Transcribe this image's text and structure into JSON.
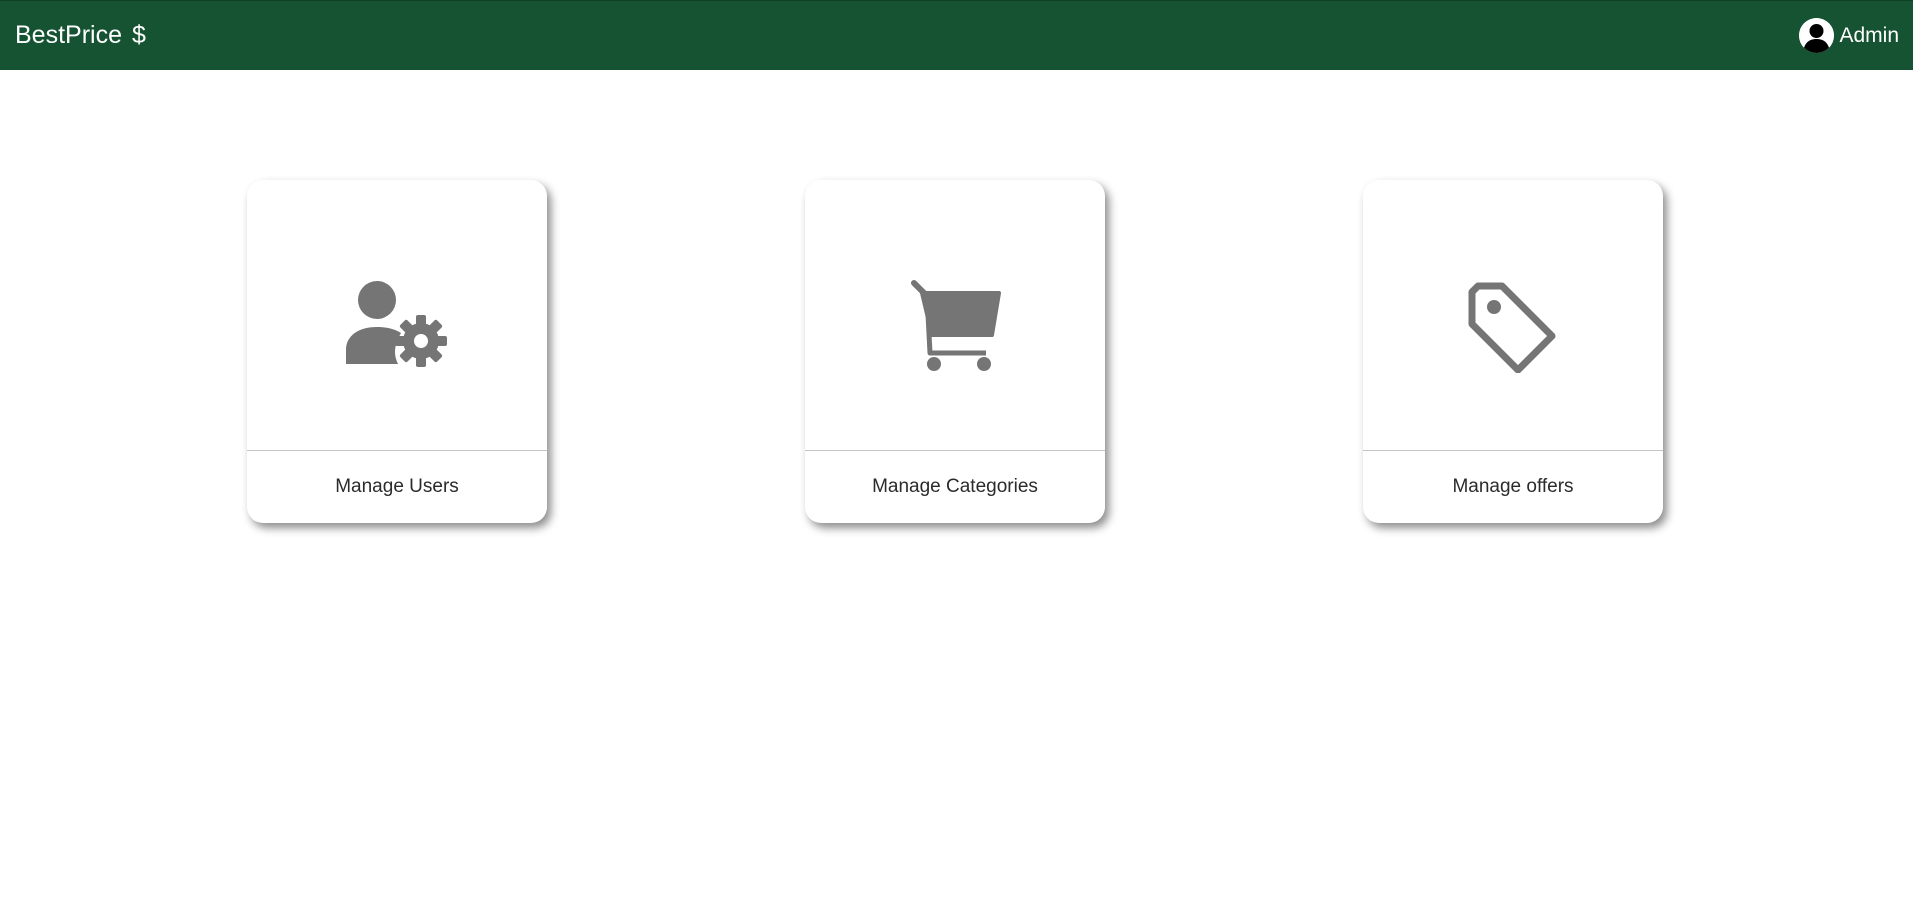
{
  "navbar": {
    "brand": "BestPrice",
    "brand_symbol": "$",
    "user_label": "Admin",
    "background": "#155332"
  },
  "cards": [
    {
      "label": "Manage Users",
      "icon": "user-gear-icon"
    },
    {
      "label": "Manage Categories",
      "icon": "shopping-cart-icon"
    },
    {
      "label": "Manage offers",
      "icon": "price-tag-icon"
    }
  ],
  "colors": {
    "icon": "#757575",
    "card_text": "#2b2b2b"
  }
}
